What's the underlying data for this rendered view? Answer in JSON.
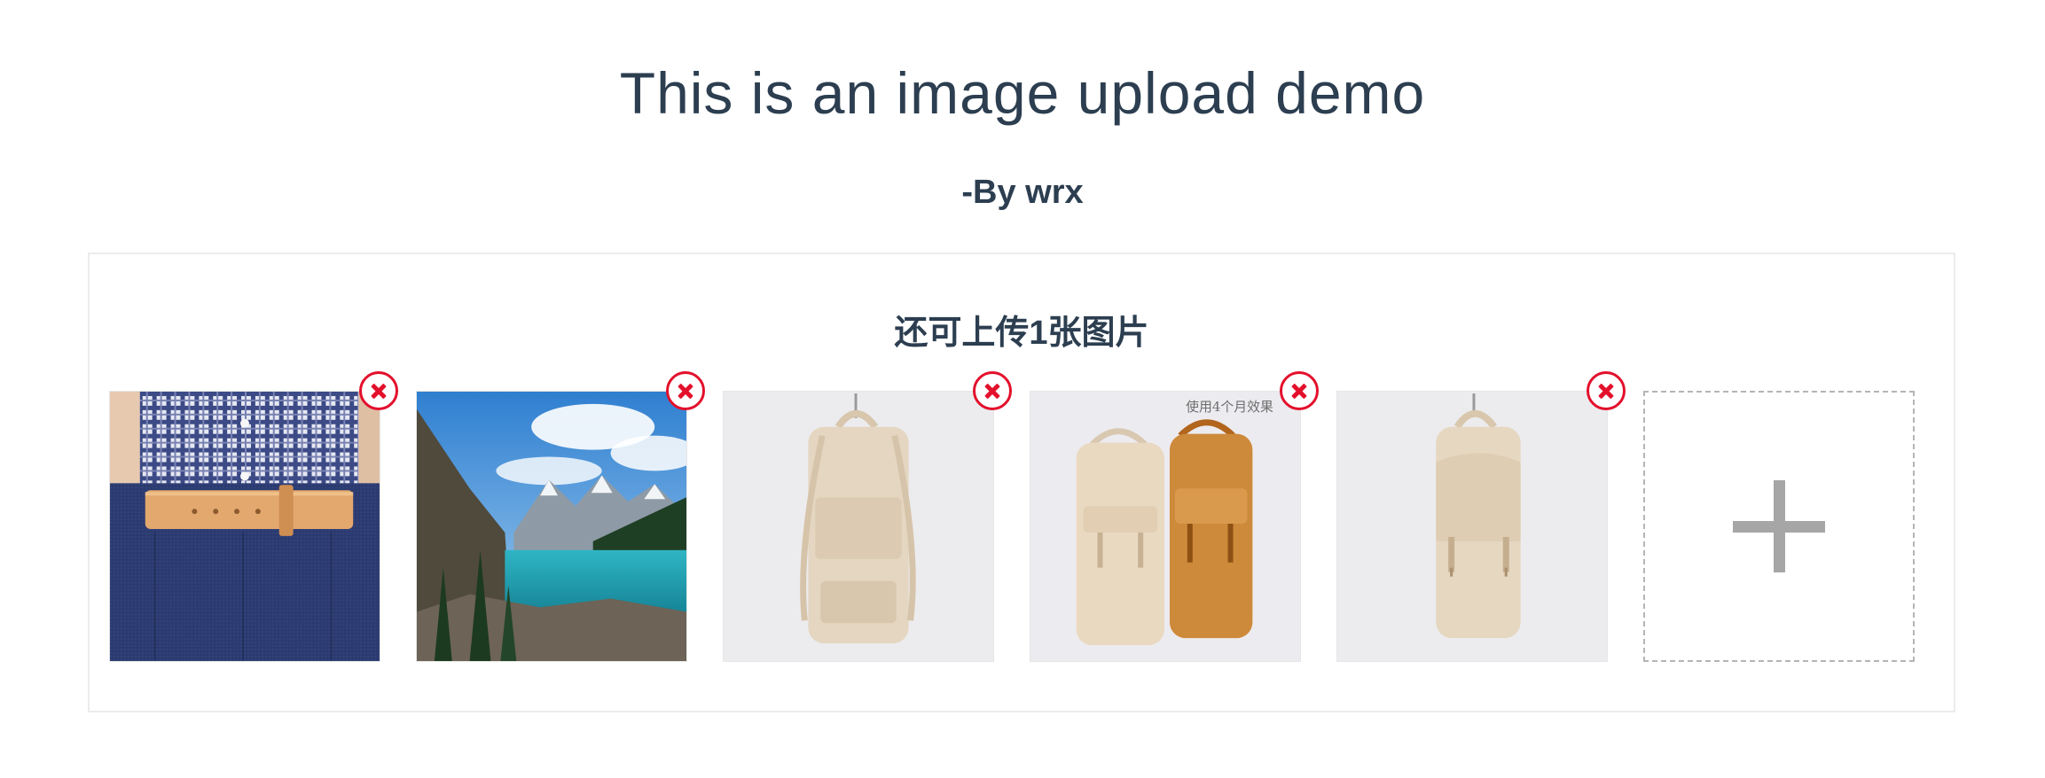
{
  "header": {
    "title": "This is an image upload demo",
    "author": "-By wrx"
  },
  "uploader": {
    "remaining_text": "还可上传1张图片",
    "images": [
      {
        "name": "plaid-shirt-belt-photo",
        "remove_icon": "close-icon"
      },
      {
        "name": "mountain-lake-photo",
        "remove_icon": "close-icon"
      },
      {
        "name": "beige-backpack-back-photo",
        "remove_icon": "close-icon"
      },
      {
        "name": "two-backpacks-photo",
        "remove_icon": "close-icon",
        "overlay_text": "使用4个月效果"
      },
      {
        "name": "beige-backpack-front-photo",
        "remove_icon": "close-icon"
      }
    ],
    "add_icon": "plus-icon"
  },
  "colors": {
    "text": "#2c3e50",
    "remove_accent": "#e3102c",
    "add_border": "#b5b5b5",
    "add_icon": "#a6a6a6"
  }
}
